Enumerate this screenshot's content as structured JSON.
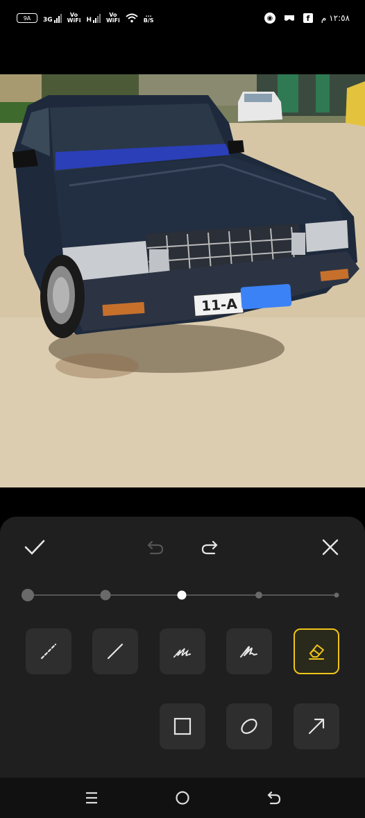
{
  "status_bar": {
    "battery_text": "9A",
    "net1": "3G",
    "net2_top": "Vo",
    "net2_bottom": "WiFi",
    "net3": "H",
    "net4_top": "Vo",
    "net4_bottom": "WiFi",
    "speed_top": "...",
    "speed_bottom": "B/S",
    "time": "١٢:٥٨ م"
  },
  "photo": {
    "plate_text": "11-A",
    "description_icon": "car-photo"
  },
  "editor": {
    "confirm_icon": "check-icon",
    "undo_icon": "undo-icon",
    "redo_icon": "redo-icon",
    "close_icon": "close-icon",
    "brush_sizes": 5,
    "selected_brush_size_index": 2,
    "tools_row1": [
      "dashed-line-tool",
      "straight-line-tool",
      "dotted-brush-tool",
      "scribble-pen-tool",
      "eraser-tool"
    ],
    "tools_row2": [
      "rectangle-tool",
      "ellipse-tool",
      "arrow-tool"
    ],
    "active_tool": "eraser-tool",
    "accent_color": "#f0c419"
  },
  "navbar": {
    "icons": [
      "recents-icon",
      "home-icon",
      "back-icon"
    ]
  }
}
